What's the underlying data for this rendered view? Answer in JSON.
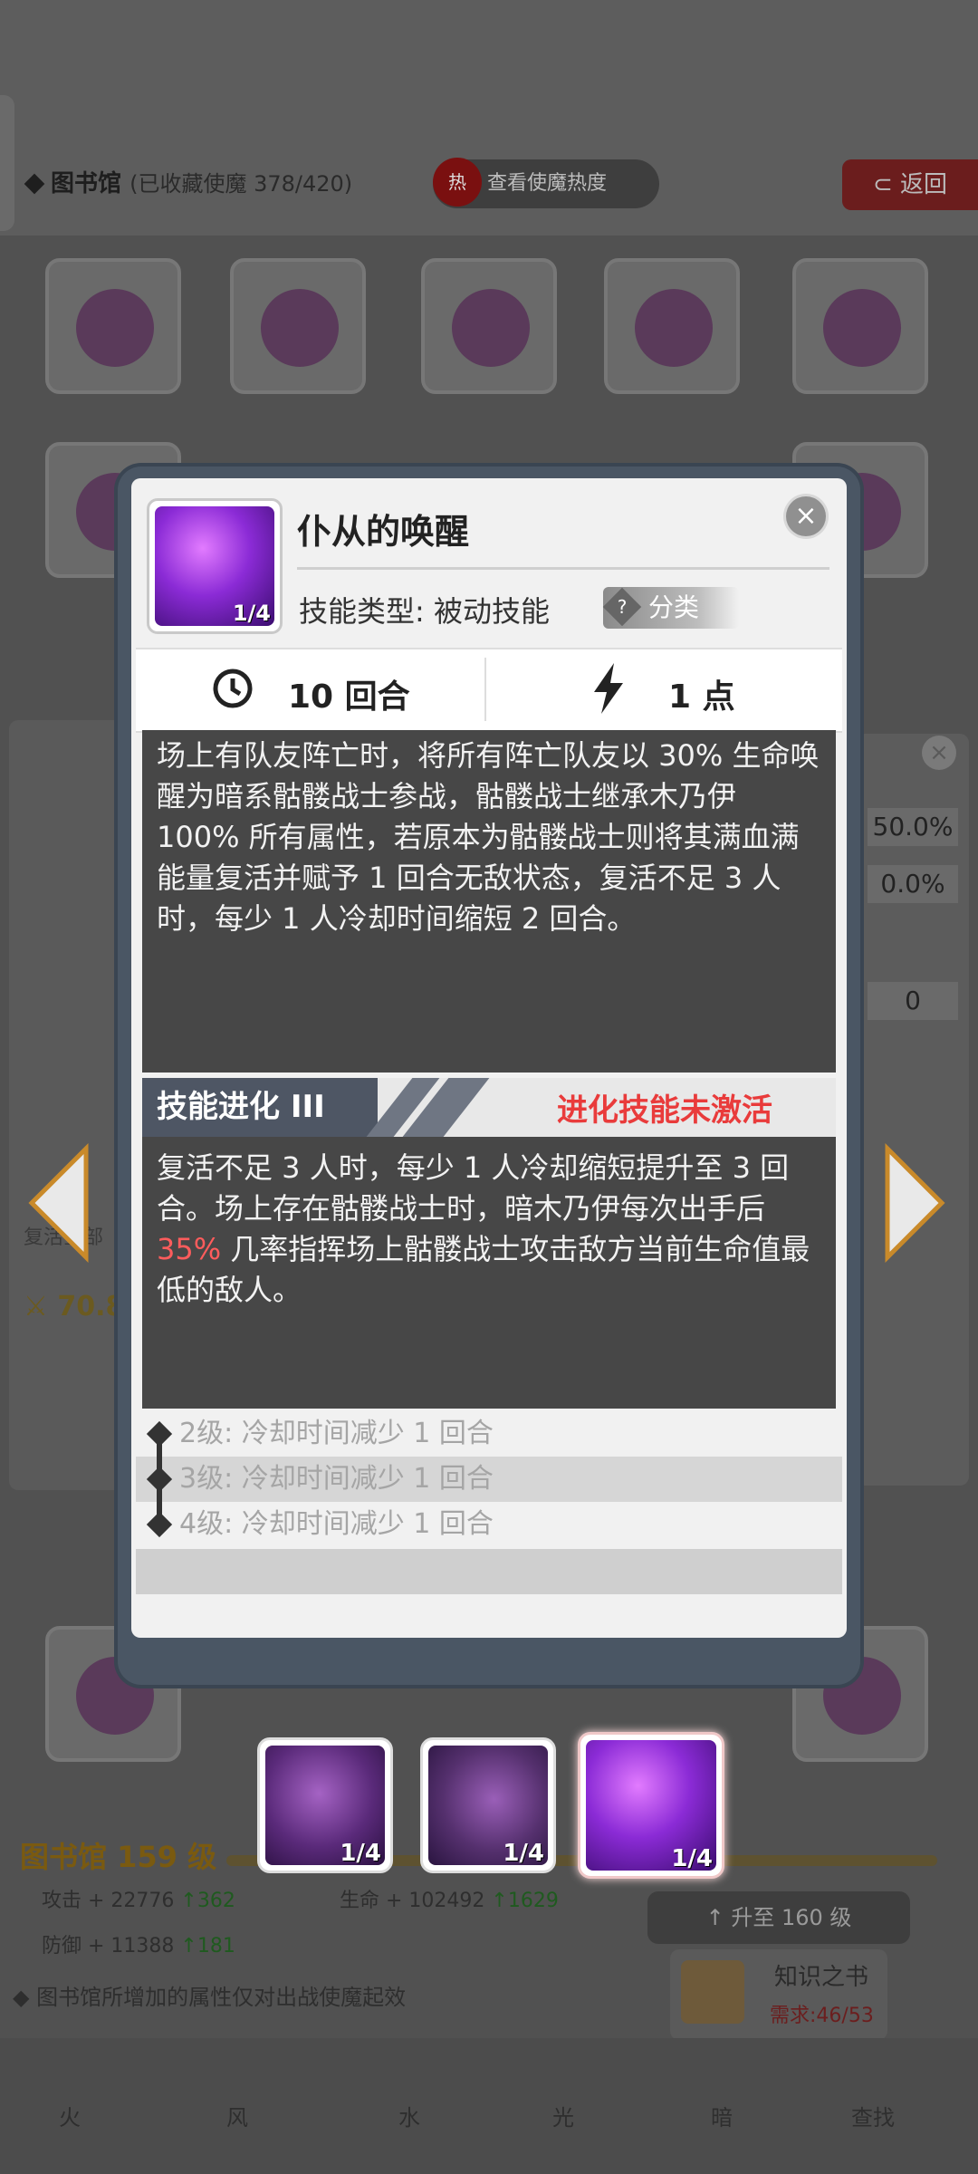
{
  "background": {
    "library_title": "图书馆",
    "collected": "(已收藏使魔 378/420)",
    "heat_badge": "热",
    "heat_button": "查看使魔热度",
    "back_button": "返回",
    "library_level": "图书馆 159 级",
    "attack": "攻击 + 22776",
    "attack_up": "362",
    "defense": "防御 + 11388",
    "defense_up": "181",
    "hp": "生命 + 102492",
    "hp_up": "1629",
    "upgrade_button": "升至 160 级",
    "book_name": "知识之书",
    "book_need": "需求:46/53",
    "note": "图书馆所增加的属性仅对出战使魔起效",
    "right_values": [
      "50.0%",
      "0.0%",
      "0"
    ],
    "left_partial_text": "复活全部",
    "left_partial_value": "70.8",
    "nav": [
      "火",
      "风",
      "水",
      "光",
      "暗",
      "查找"
    ]
  },
  "modal": {
    "skill_level": "1/4",
    "skill_name": "仆从的唤醒",
    "skill_type": "技能类型: 被动技能",
    "category": "分类",
    "category_q": "?",
    "close": "×",
    "cooldown": "10 回合",
    "cost": "1 点",
    "description": "场上有队友阵亡时，将所有阵亡队友以 30% 生命唤醒为暗系骷髅战士参战，骷髅战士继承木乃伊 100% 所有属性，若原本为骷髅战士则将其满血满能量复活并赋予 1 回合无敌状态，复活不足 3 人时，每少 1 人冷却时间缩短 2 回合。",
    "evolution_label": "技能进化 III",
    "evolution_status": "进化技能未激活",
    "evolution_text_1": "复活不足 3 人时，每少 1 人冷却缩短提升至 3 回合。场上存在骷髅战士时，暗木乃伊每次出手后 ",
    "evolution_highlight": "35%",
    "evolution_text_2": " 几率指挥场上骷髅战士攻击敌方当前生命值最低的敌人。",
    "levels": [
      "2级: 冷却时间减少 1 回合",
      "3级: 冷却时间减少 1 回合",
      "4级: 冷却时间减少 1 回合"
    ]
  },
  "tabs": [
    {
      "level": "1/4",
      "icon": "hand-cross-icon"
    },
    {
      "level": "1/4",
      "icon": "target-staff-icon"
    },
    {
      "level": "1/4",
      "icon": "skull-ankh-icon"
    }
  ]
}
